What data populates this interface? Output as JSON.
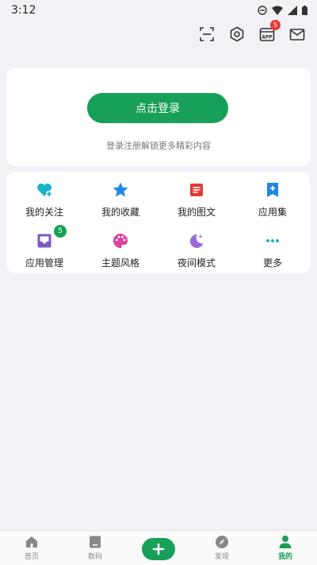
{
  "status_bar": {
    "time": "3:12"
  },
  "toolbar": {
    "icons": [
      "scan-icon",
      "settings-icon",
      "app-icon",
      "mail-icon"
    ],
    "app_badge": "5"
  },
  "login": {
    "button_label": "点击登录",
    "hint": "登录注册解锁更多精彩内容"
  },
  "menu": {
    "items": [
      {
        "label": "我的关注",
        "icon": "heart-plus-icon",
        "color": "#1db2c8"
      },
      {
        "label": "我的收藏",
        "icon": "star-icon",
        "color": "#1e88e5"
      },
      {
        "label": "我的图文",
        "icon": "document-icon",
        "color": "#e53935"
      },
      {
        "label": "应用集",
        "icon": "bookmark-plus-icon",
        "color": "#1e88e5"
      },
      {
        "label": "应用管理",
        "icon": "inbox-icon",
        "color": "#7e57c2",
        "badge": "5"
      },
      {
        "label": "主题风格",
        "icon": "palette-icon",
        "color": "#e040a0"
      },
      {
        "label": "夜间模式",
        "icon": "moon-icon",
        "color": "#9c6ade"
      },
      {
        "label": "更多",
        "icon": "more-dots-icon",
        "color": "#1db2c8"
      }
    ]
  },
  "bottom_nav": {
    "items": [
      {
        "label": "首页",
        "icon": "home-icon"
      },
      {
        "label": "数码",
        "icon": "device-icon"
      },
      {
        "label": "",
        "icon": "add-icon"
      },
      {
        "label": "发现",
        "icon": "compass-icon"
      },
      {
        "label": "我的",
        "icon": "person-icon",
        "active": true
      }
    ]
  },
  "colors": {
    "accent": "#18a058",
    "background": "#f2f2f6",
    "badge_red": "#e53935"
  }
}
